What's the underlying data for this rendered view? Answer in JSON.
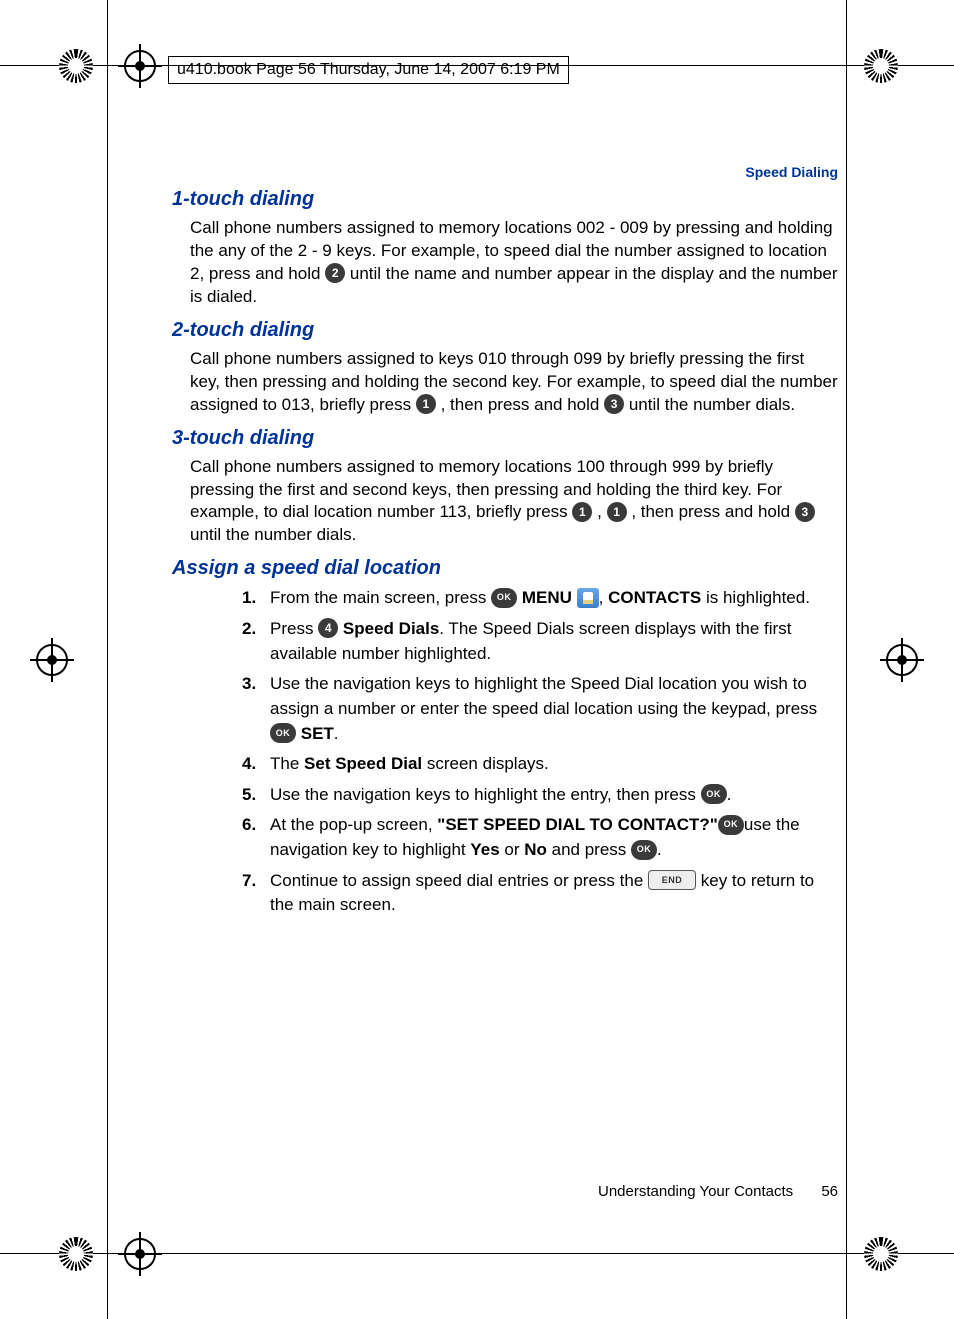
{
  "header_text": "u410.book  Page 56  Thursday, June 14, 2007  6:19 PM",
  "section_label": "Speed Dialing",
  "h1": {
    "title": "1-touch dialing",
    "para_a": "Call phone numbers assigned to memory locations 002 - 009 by pressing and holding the any of the 2 - 9 keys. For example, to speed dial the number assigned to location 2, press and hold ",
    "key1": "2",
    "para_b": " until the name and number appear in the display and the number is dialed."
  },
  "h2": {
    "title": "2-touch dialing",
    "para_a": "Call phone numbers assigned to keys 010 through 099 by briefly pressing the first key, then pressing and holding the second key. For example, to speed dial the number assigned to 013, briefly press ",
    "key1": "1",
    "para_b": ", then press and hold ",
    "key2": "3",
    "para_c": " until the number dials."
  },
  "h3": {
    "title": "3-touch dialing",
    "para_a": "Call phone numbers assigned to memory locations 100 through 999 by briefly pressing the first and second keys, then pressing and holding the third key. For example, to dial location number 113, briefly press ",
    "key1": "1",
    "para_b": ", ",
    "key2": "1",
    "para_c": ", then press and hold ",
    "key3": "3",
    "para_d": " until the number dials."
  },
  "assign": {
    "title": "Assign a speed dial location",
    "steps": [
      {
        "n": "1.",
        "a": "From the main screen, press ",
        "ok1": "OK",
        "b": " ",
        "boldb": "MENU",
        "c": ", ",
        "contacts_icon": true,
        "d": " ",
        "boldd": "CONTACTS",
        "e": " is highlighted."
      },
      {
        "n": "2.",
        "a": "Press ",
        "key": "4",
        "b": " ",
        "boldb": "Speed Dials",
        "c": ". The Speed Dials screen displays with the first available number highlighted."
      },
      {
        "n": "3.",
        "a": "Use the navigation keys to highlight the Speed Dial location you wish to assign a number or enter the speed dial location using the keypad, press ",
        "ok1": "OK",
        "b": " ",
        "boldb": "SET",
        "c": "."
      },
      {
        "n": "4.",
        "a": "The ",
        "bolda": "Set Speed Dial",
        "b": " screen displays."
      },
      {
        "n": "5.",
        "a": "Use the navigation keys to highlight the entry, then press ",
        "ok1": "OK",
        "b": "."
      },
      {
        "n": "6.",
        "a": "At the pop-up screen, ",
        "bolda": "\"SET SPEED DIAL TO CONTACT?\"",
        "b": "use the navigation key to highlight ",
        "boldb": "Yes",
        "c": " or ",
        "boldc": "No",
        "d": " and press ",
        "ok1": "OK",
        "e": "."
      },
      {
        "n": "7.",
        "a": "Continue to assign speed dial entries or press the ",
        "end": "END",
        "b": " key to return to the main screen."
      }
    ]
  },
  "footer_text": "Understanding Your Contacts",
  "page_number": "56"
}
